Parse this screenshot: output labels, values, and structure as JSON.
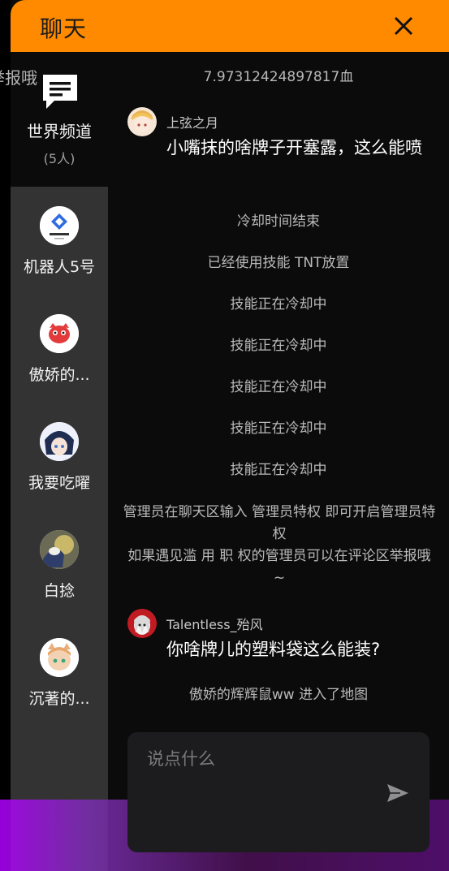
{
  "header": {
    "title": "聊天"
  },
  "overlay_fragment": "举报哦",
  "sidebar": {
    "channel": {
      "name": "世界频道",
      "count": "(5人)"
    },
    "users": [
      {
        "name": "机器人5号"
      },
      {
        "name": "傲娇的..."
      },
      {
        "name": "我要吃曜"
      },
      {
        "name": "白捻"
      },
      {
        "name": "沉著的..."
      }
    ]
  },
  "messages": {
    "top_value": "7.97312424897817血",
    "msg1": {
      "user": "上弦之月",
      "text": "小嘴抹的啥牌子开塞露，这么能喷"
    },
    "sys1": "冷却时间结束",
    "sys2": "已经使用技能 TNT放置",
    "sys3": "技能正在冷却中",
    "sys4": "技能正在冷却中",
    "sys5": "技能正在冷却中",
    "sys6": "技能正在冷却中",
    "sys7": "技能正在冷却中",
    "notice_line1": "管理员在聊天区输入 管理员特权 即可开启管理员特权",
    "notice_line2": "如果遇见滥 用 职 权的管理员可以在评论区举报哦~",
    "msg2": {
      "user": "Talentless_殆风",
      "text": "你啥牌儿的塑料袋这么能装?"
    },
    "sys8": "傲娇的辉辉鼠ww 进入了地图"
  },
  "input": {
    "placeholder": "说点什么"
  },
  "colors": {
    "header": "#ff8a00",
    "sidebar": "#333334",
    "background": "#0b0b0c"
  }
}
